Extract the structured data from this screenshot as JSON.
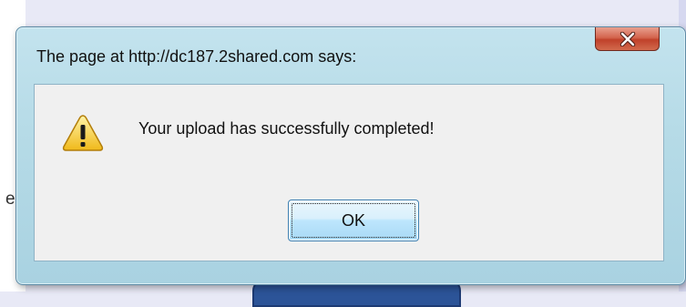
{
  "background": {
    "partial_letter": "e"
  },
  "dialog": {
    "title": "The page at http://dc187.2shared.com says:",
    "message": "Your upload has successfully completed!",
    "ok_label": "OK",
    "close_icon": "close-icon",
    "message_icon": "warning-icon"
  },
  "colors": {
    "frame": "#b6dbe7",
    "close_button": "#c8452e",
    "content_bg": "#f0f0f0",
    "ok_button": "#bee6fd"
  }
}
